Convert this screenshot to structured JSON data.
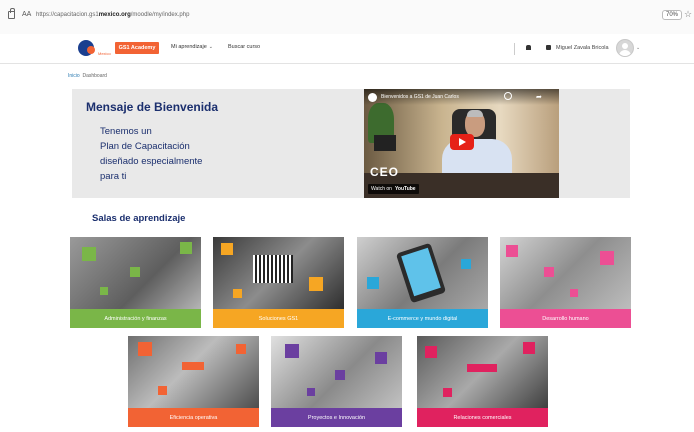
{
  "browser": {
    "aa": "AA",
    "url_prefix": "https://capacitacion.gs1",
    "url_domain": "mexico.org",
    "url_suffix": "/moodle/my/index.php",
    "zoom": "70%"
  },
  "header": {
    "logo_sub": "Mexico",
    "academy_label": "GS1 Academy",
    "nav": [
      {
        "label": "Mi aprendizaje"
      },
      {
        "label": "Buscar curso"
      }
    ],
    "user_name": "Miguel Zavala Bricola"
  },
  "breadcrumb": {
    "home": "Inicio",
    "current": "Dashboard"
  },
  "welcome": {
    "title": "Mensaje de Bienvenida",
    "lines": [
      "Tenemos un",
      "Plan de Capacitación",
      "diseñado especialmente",
      "para ti"
    ]
  },
  "video": {
    "title": "Bienvenidos a GS1 de Juan Carlos",
    "overlay_text": "CEO",
    "watch_label": "Watch on",
    "platform": "YouTube"
  },
  "section": {
    "title": "Salas de aprendizaje"
  },
  "cards": [
    {
      "label": "Administración y finanzas",
      "color": "#7ab648",
      "accent": "#7ab648"
    },
    {
      "label": "Soluciones GS1",
      "color": "#f6a623",
      "accent": "#f6a623"
    },
    {
      "label": "E-commerce y mundo digital",
      "color": "#2aa7d9",
      "accent": "#2aa7d9"
    },
    {
      "label": "Desarrollo humano",
      "color": "#ec4f94",
      "accent": "#ec4f94"
    },
    {
      "label": "Eficiencia operativa",
      "color": "#f26334",
      "accent": "#f26334"
    },
    {
      "label": "Proyectos e Innovación",
      "color": "#6b3fa0",
      "accent": "#6b3fa0"
    },
    {
      "label": "Relaciones comerciales",
      "color": "#e0225f",
      "accent": "#e0225f"
    }
  ],
  "colors": {
    "brand_navy": "#1b2f6e",
    "brand_orange": "#f26334",
    "youtube_red": "#e62117"
  },
  "icons": [
    "lock-icon",
    "star-icon",
    "bell-icon",
    "chat-icon",
    "avatar-icon",
    "play-icon",
    "youtube-logo-icon"
  ]
}
